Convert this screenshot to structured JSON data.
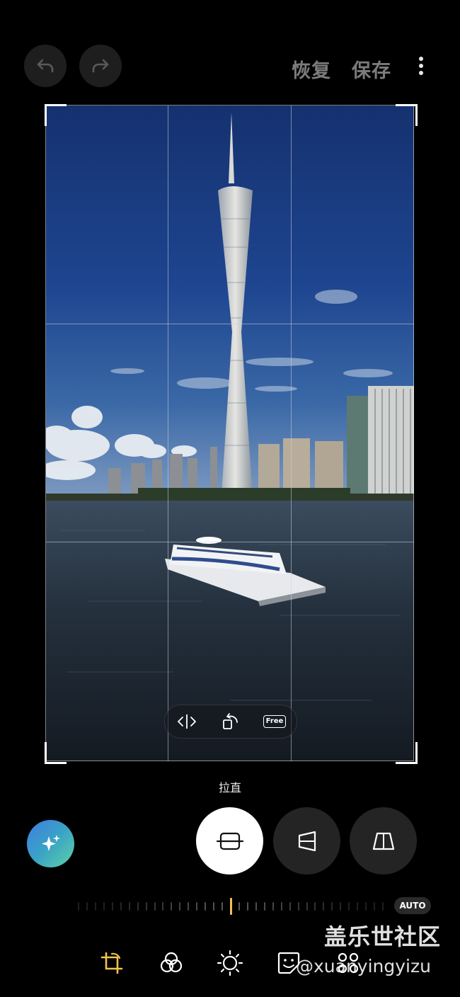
{
  "header": {
    "undo_icon": "undo-icon",
    "redo_icon": "redo-icon",
    "revert_label": "恢复",
    "save_label": "保存",
    "more_icon": "more-vertical-icon"
  },
  "photo": {
    "description_icon": "photo-canvas"
  },
  "photo_controls": {
    "flip_icon": "flip-horizontal-icon",
    "rotate_icon": "rotate-icon",
    "free_label": "Free"
  },
  "mode_label": "拉直",
  "ai_button_icon": "sparkle-icon",
  "transform_tools": [
    {
      "name": "straighten",
      "icon": "straighten-icon",
      "active": true
    },
    {
      "name": "vertical-perspective",
      "icon": "vertical-perspective-icon",
      "active": false
    },
    {
      "name": "horizontal-perspective",
      "icon": "horizontal-perspective-icon",
      "active": false
    }
  ],
  "ruler": {
    "auto_label": "AUTO",
    "value": 0
  },
  "bottom_nav": [
    {
      "name": "crop",
      "icon": "crop-rotate-icon",
      "active": true
    },
    {
      "name": "filters",
      "icon": "filters-icon",
      "active": false
    },
    {
      "name": "adjust",
      "icon": "brightness-icon",
      "active": false
    },
    {
      "name": "decorations",
      "icon": "sticker-icon",
      "active": false
    },
    {
      "name": "more-tools",
      "icon": "more-tools-icon",
      "active": false
    }
  ],
  "watermark": {
    "title": "盖乐世社区",
    "handle": "@xuanyingyizu"
  },
  "colors": {
    "accent": "#f2c24e",
    "sky": "#1b3c82",
    "water": "#24313f"
  }
}
